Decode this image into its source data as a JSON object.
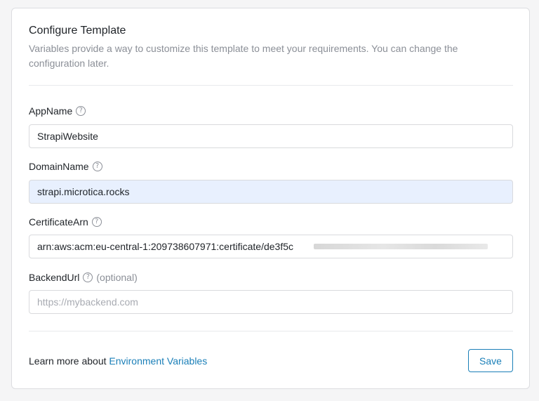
{
  "form": {
    "title": "Configure Template",
    "description": "Variables provide a way to customize this template to meet your requirements. You can change the configuration later.",
    "fields": [
      {
        "label": "AppName",
        "value": "StrapiWebsite",
        "placeholder": "",
        "optional_text": ""
      },
      {
        "label": "DomainName",
        "value": "strapi.microtica.rocks",
        "placeholder": "",
        "optional_text": ""
      },
      {
        "label": "CertificateArn",
        "value": "arn:aws:acm:eu-central-1:209738607971:certificate/de3f5c",
        "placeholder": "",
        "optional_text": ""
      },
      {
        "label": "BackendUrl",
        "value": "",
        "placeholder": "https://mybackend.com",
        "optional_text": "(optional)"
      }
    ],
    "help_icon_glyph": "?"
  },
  "footer": {
    "learn_more_prefix": "Learn more about ",
    "learn_more_link": "Environment Variables",
    "save_label": "Save"
  },
  "colors": {
    "accent": "#1a7fb8",
    "autofill_background": "#e8f0fe",
    "muted_text": "#8b8f97"
  },
  "icons": {
    "help": "question-circle-icon"
  }
}
